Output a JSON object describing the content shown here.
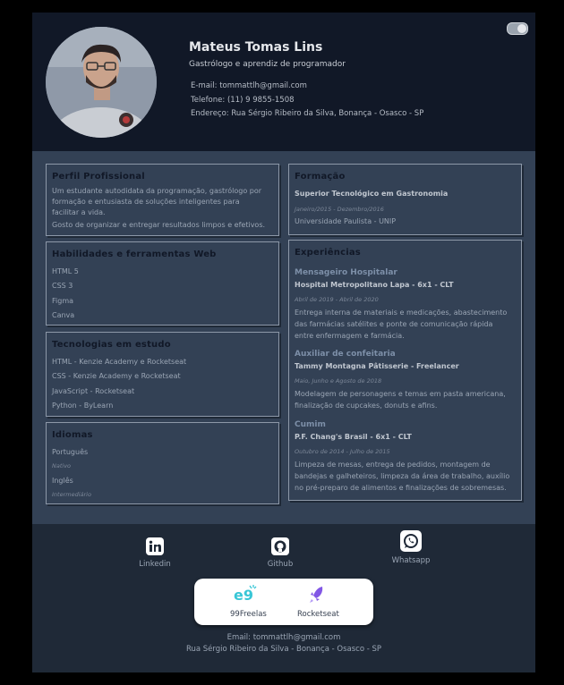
{
  "header": {
    "name": "Mateus Tomas Lins",
    "role": "Gastrólogo e aprendiz de programador",
    "email": "E-mail: tommattlh@gmail.com",
    "phone": "Telefone: (11) 9 9855-1508",
    "address": "Endereço: Rua Sérgio Ribeiro da Silva, Bonança - Osasco - SP"
  },
  "profile": {
    "title": "Perfil Profissional",
    "lines": [
      "Um estudante autodidata da programação, gastrólogo por",
      "formação e entusiasta de soluções inteligentes para",
      "facilitar a vida.",
      "Gosto de organizar e entregar resultados limpos e efetivos."
    ]
  },
  "skills": {
    "title": "Habilidades e ferramentas Web",
    "items": [
      "HTML 5",
      "CSS 3",
      "Figma",
      "Canva"
    ]
  },
  "studying": {
    "title": "Tecnologias em estudo",
    "items": [
      "HTML - Kenzie Academy e Rocketseat",
      "CSS - Kenzie Academy e Rocketseat",
      "JavaScript - Rocketseat",
      "Python - ByLearn"
    ]
  },
  "languages": {
    "title": "Idiomas",
    "items": [
      {
        "name": "Português",
        "level": "Nativo"
      },
      {
        "name": "Inglês",
        "level": "Intermediário"
      }
    ]
  },
  "education": {
    "title": "Formação",
    "degree": "Superior Tecnológico em Gastronomia",
    "period": "Janeiro/2015 - Dezembro/2016",
    "school": "Universidade Paulista - UNIP"
  },
  "experience": {
    "title": "Experiências",
    "jobs": [
      {
        "role": "Mensageiro Hospitalar",
        "company": "Hospital Metropolitano Lapa - 6x1 - CLT",
        "period": "Abril de 2019 - Abril de 2020",
        "desc": [
          "Entrega interna de materiais e medicações, abastecimento",
          "das farmácias satélites e ponte de comunicação rápida",
          "entre enfermagem e farmácia."
        ]
      },
      {
        "role": "Auxiliar de confeitaria",
        "company": "Tammy Montagna Pâtisserie - Freelancer",
        "period": "Maio, Junho e Agosto de 2018",
        "desc": [
          "Modelagem de personagens e temas em pasta americana,",
          "finalização de cupcakes, donuts e afins."
        ]
      },
      {
        "role": "Cumim",
        "company": "P.F. Chang's Brasil - 6x1 - CLT",
        "period": "Outubro de 2014 - Julho de 2015",
        "desc": [
          "Limpeza de mesas, entrega de pedidos, montagem de",
          "bandejas e galheteiros, limpeza da área de trabalho, auxílio",
          "no pré-preparo de alimentos e finalizações de sobremesas."
        ]
      }
    ]
  },
  "footer": {
    "social": [
      {
        "label": "Linkedin",
        "icon": "linkedin-icon"
      },
      {
        "label": "Github",
        "icon": "github-icon"
      },
      {
        "label": "Whatsapp",
        "icon": "whatsapp-icon"
      }
    ],
    "freelas": [
      {
        "label": "99Freelas",
        "icon": "99freelas-icon"
      },
      {
        "label": "Rocketseat",
        "icon": "rocketseat-icon"
      }
    ],
    "email": "Email: tommattlh@gmail.com",
    "address": "Rua Sérgio Ribeiro da Silva - Bonança - Osasco - SP"
  }
}
